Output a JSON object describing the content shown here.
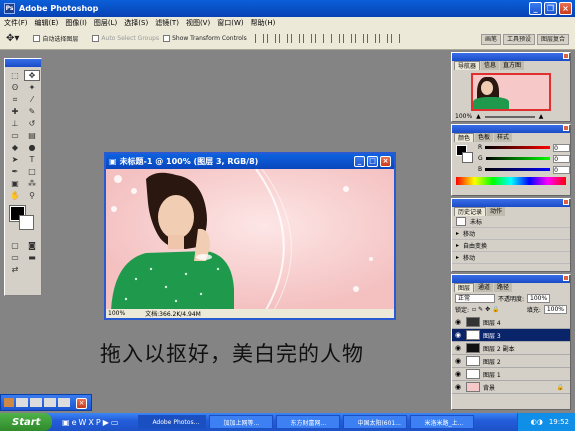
{
  "app": {
    "title": "Adobe Photoshop"
  },
  "menu": [
    "文件(F)",
    "编辑(E)",
    "图像(I)",
    "图层(L)",
    "选择(S)",
    "滤镜(T)",
    "视图(V)",
    "窗口(W)",
    "帮助(H)"
  ],
  "options": {
    "auto_select_layer": "自动选择图层",
    "auto_select_groups": "Auto Select Groups",
    "show_transform_controls": "Show Transform Controls",
    "right_tabs": [
      "画笔",
      "工具预设",
      "图层复合"
    ]
  },
  "document": {
    "title": "未标题-1 @ 100% (图层 3, RGB/8)",
    "zoom": "100%",
    "doc_size": "文档:366.2K/4.94M"
  },
  "caption": "拖入以抠好，美白完的人物",
  "panels": {
    "navigator": {
      "tabs": [
        "导航器",
        "信息",
        "直方图"
      ],
      "zoom": "100%"
    },
    "color": {
      "tabs": [
        "颜色",
        "色板",
        "样式"
      ],
      "labels": [
        "R",
        "G",
        "B"
      ],
      "values": [
        "0",
        "0",
        "0"
      ]
    },
    "history": {
      "tabs": [
        "历史记录",
        "动作"
      ],
      "items": [
        "未标",
        "移动",
        "自由变换",
        "移动"
      ]
    },
    "layers": {
      "tabs": [
        "图层",
        "通道",
        "路径"
      ],
      "blend_mode": "正常",
      "opacity_label": "不透明度:",
      "opacity": "100%",
      "fill_label": "填充:",
      "fill": "100%",
      "lock_label": "锁定:",
      "items": [
        "图层 4",
        "图层 3",
        "图层 2 副本",
        "图层 2",
        "图层 1",
        "背景"
      ],
      "selected_index": 1
    }
  },
  "taskbar": {
    "start": "Start",
    "buttons": [
      "Adobe Photos...",
      "加加上网等...",
      "东方财富网...",
      "中国太阳(601...",
      "米洛米路_上..."
    ],
    "clock": "19:52"
  },
  "colors": {
    "titlebar": "#0a5fd8",
    "canvas_bg": "#f6c8c8",
    "selection": "#0a246a",
    "taskbar": "#245edb"
  }
}
